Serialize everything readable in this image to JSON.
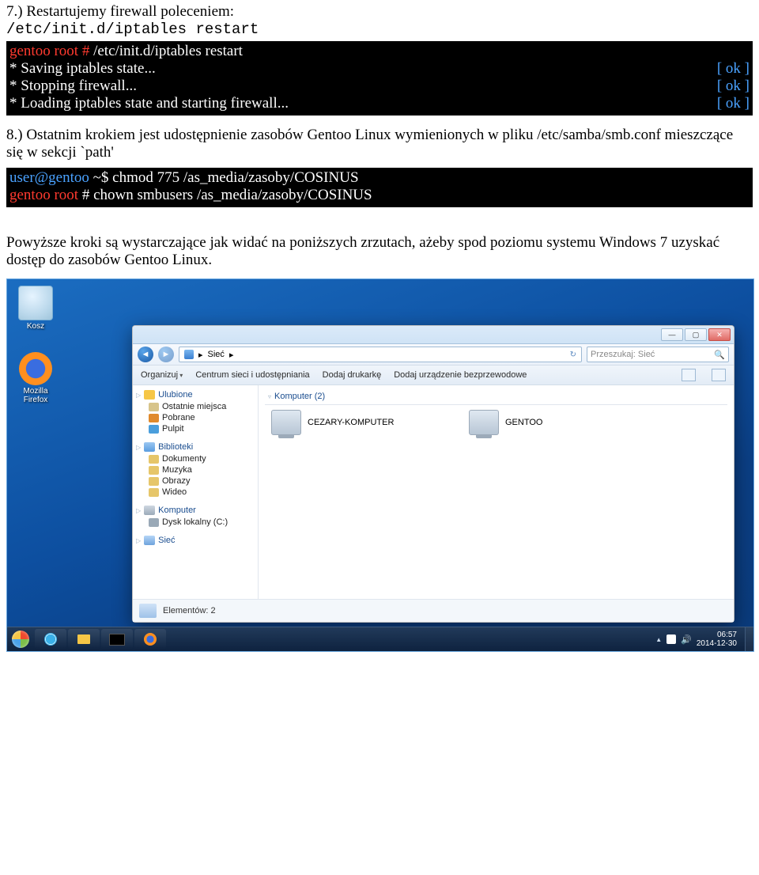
{
  "doc": {
    "step7_intro": "7.) Restartujemy firewall poleceniem:",
    "step7_cmd": "/etc/init.d/iptables restart",
    "term1": {
      "prompt_user": "gentoo root #",
      "prompt_cmd": " /etc/init.d/iptables restart",
      "lines": [
        {
          "text": " * Saving iptables state...",
          "status": "[ ok ]"
        },
        {
          "text": " * Stopping firewall...",
          "status": "[ ok ]"
        },
        {
          "text": " * Loading iptables state and starting firewall...",
          "status": "[ ok ]"
        }
      ]
    },
    "step8": "8.) Ostatnim krokiem jest udostępnienie zasobów Gentoo Linux wymienionych w pliku /etc/samba/smb.conf mieszczące się w sekcji `path'",
    "term2": {
      "l1_user": "user@gentoo",
      "l1_rest": " ~$ chmod 775 /as_media/zasoby/COSINUS",
      "l2_user": "gentoo root",
      "l2_rest": " # chown smbusers /as_media/zasoby/COSINUS"
    },
    "summary": "Powyższe kroki są wystarczające jak widać na poniższych zrzutach, ażeby spod poziomu systemu Windows 7 uzyskać dostęp do zasobów Gentoo Linux."
  },
  "desktop": {
    "recycle": "Kosz",
    "firefox": "Mozilla Firefox"
  },
  "explorer": {
    "addr_sep": "▸",
    "addr_label": "Sieć",
    "search_placeholder": "Przeszukaj: Sieć",
    "toolbar": {
      "organize": "Organizuj",
      "network_center": "Centrum sieci i udostępniania",
      "add_printer": "Dodaj drukarkę",
      "add_wireless": "Dodaj urządzenie bezprzewodowe"
    },
    "sidebar": {
      "favorites": "Ulubione",
      "fav_items": {
        "recent": "Ostatnie miejsca",
        "downloads": "Pobrane",
        "desktop": "Pulpit"
      },
      "libraries": "Biblioteki",
      "lib_items": {
        "documents": "Dokumenty",
        "music": "Muzyka",
        "pictures": "Obrazy",
        "videos": "Wideo"
      },
      "computer": "Komputer",
      "comp_items": {
        "cdrive": "Dysk lokalny (C:)"
      },
      "network": "Sieć"
    },
    "section_label": "Komputer (2)",
    "items": {
      "pc1": "CEZARY-KOMPUTER",
      "pc2": "GENTOO"
    },
    "status": "Elementów: 2"
  },
  "taskbar": {
    "time": "06:57",
    "date": "2014-12-30"
  }
}
